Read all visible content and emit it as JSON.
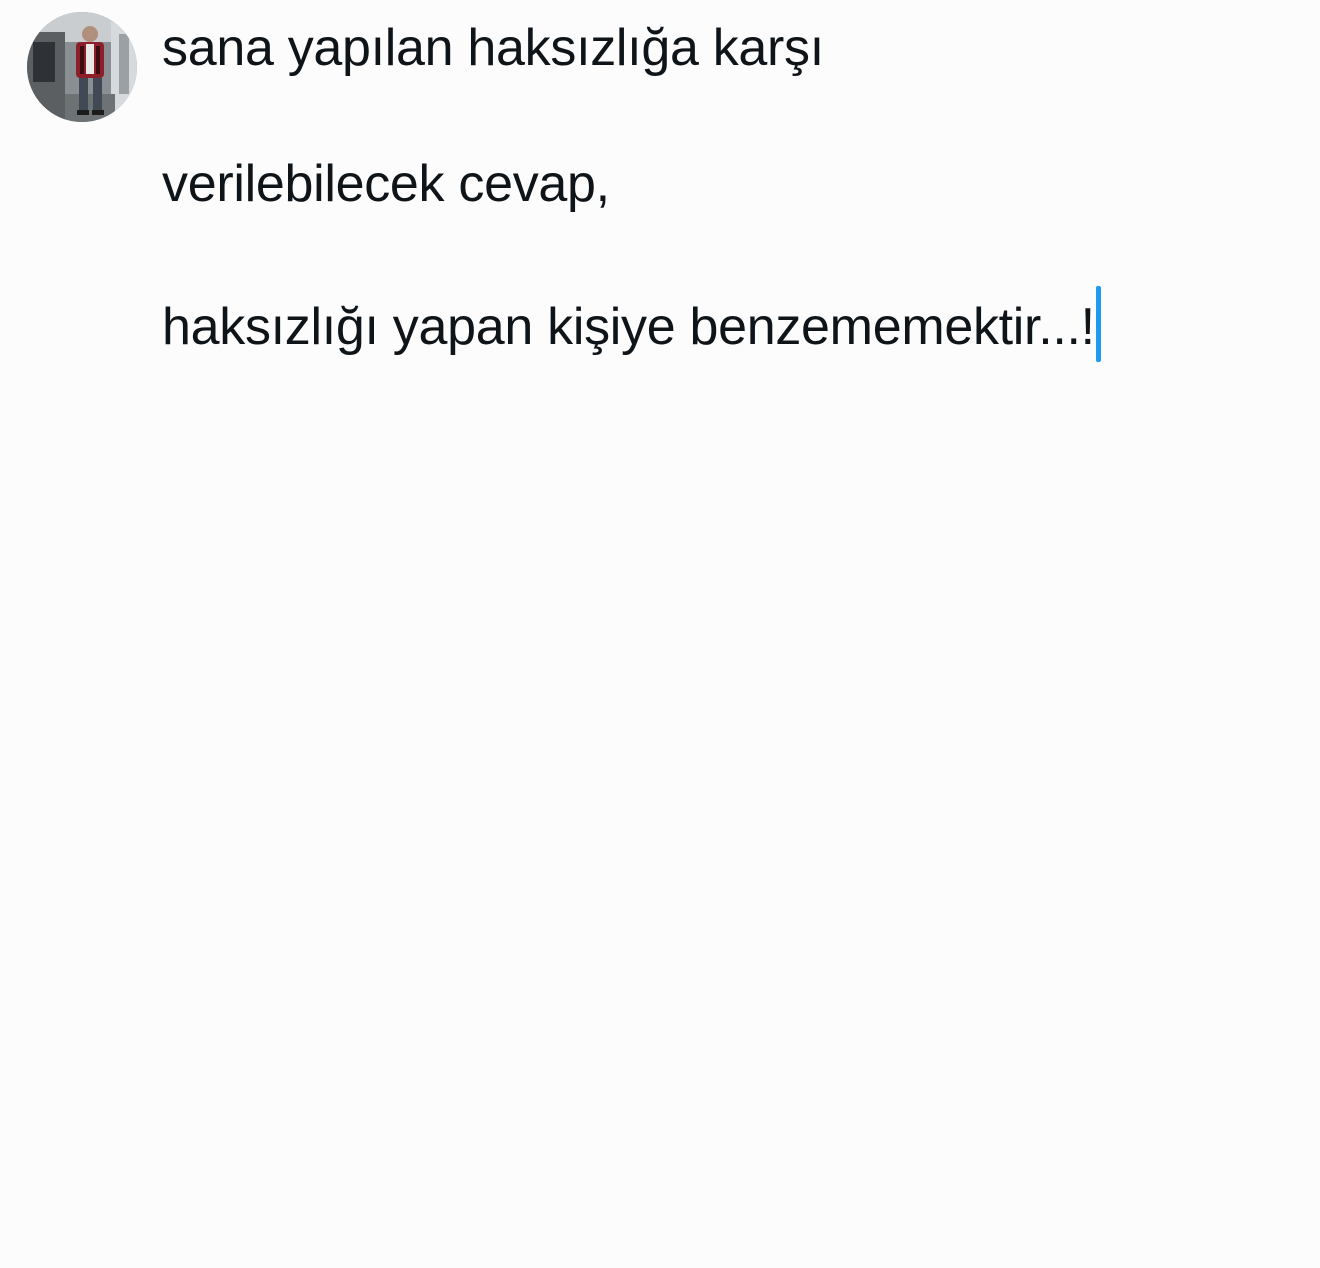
{
  "composer": {
    "avatar_icon": "profile-photo",
    "lines": [
      "sana yapılan haksızlığa karşı",
      "verilebilecek cevap,",
      "haksızlığı yapan kişiye benzememektir...!"
    ]
  },
  "colors": {
    "background": "#fcfcfd",
    "text": "#0f1419",
    "caret": "#1d9bf0"
  }
}
